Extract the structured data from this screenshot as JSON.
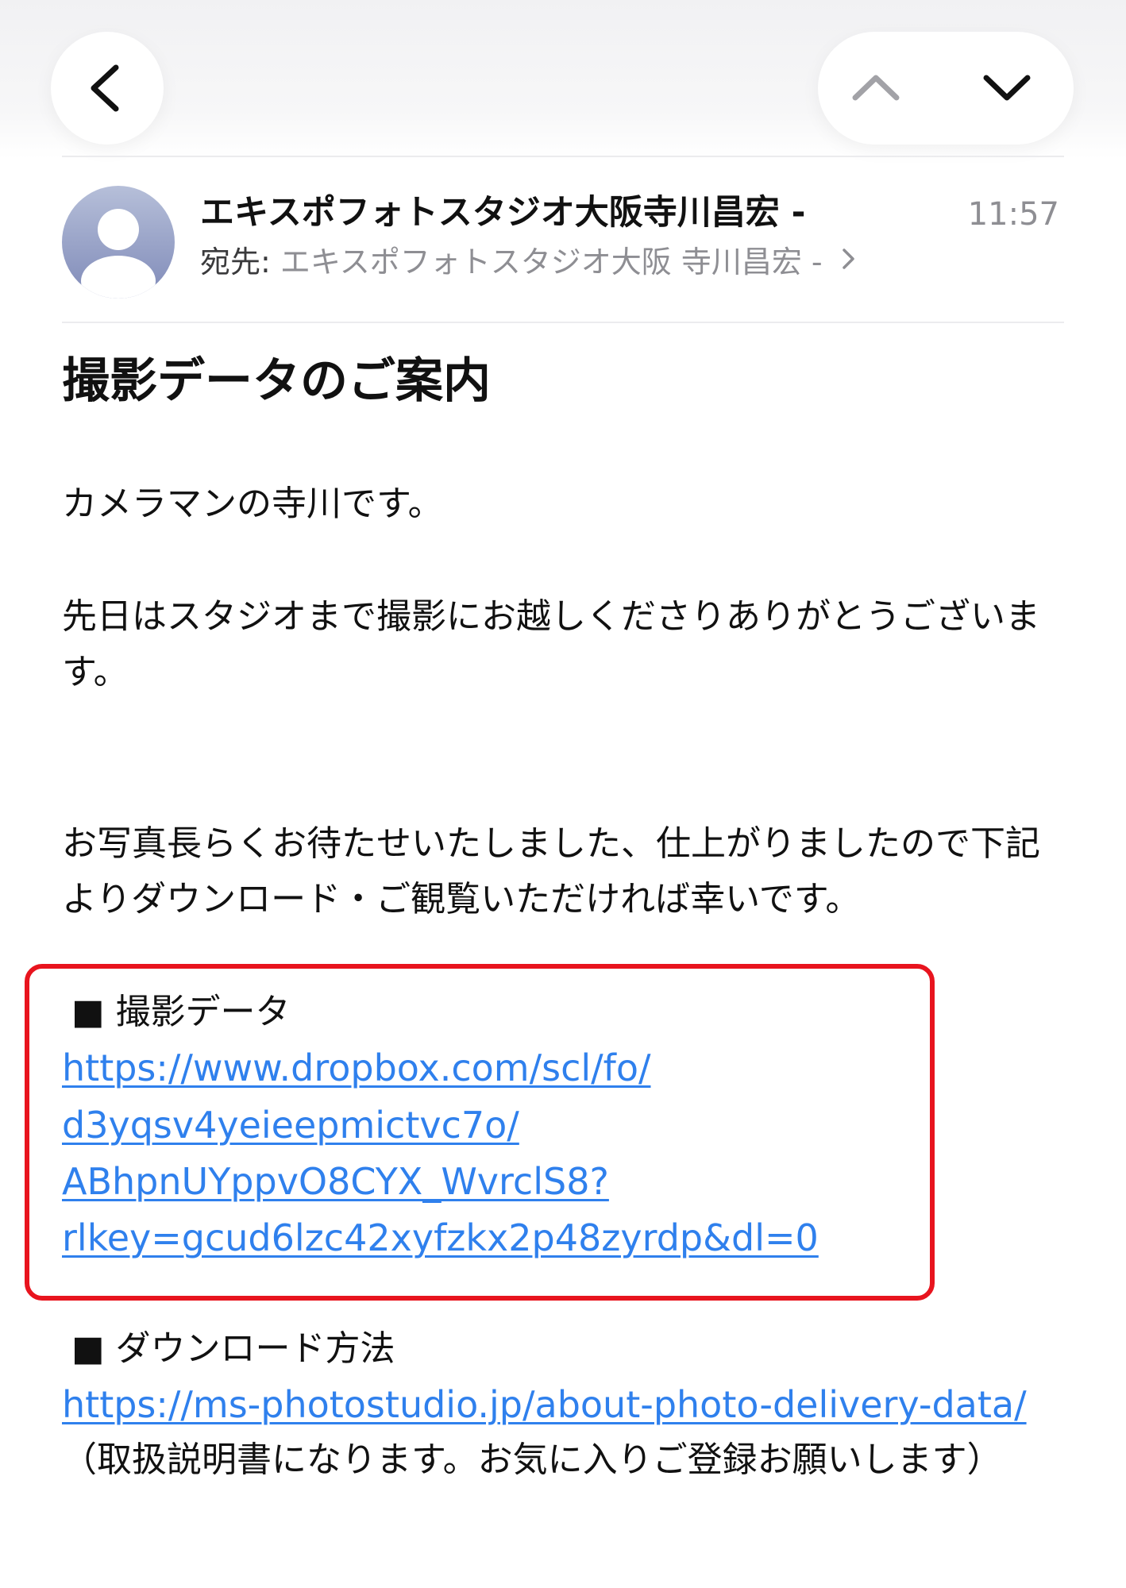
{
  "navigation": {
    "back_icon": "chevron-left-icon",
    "prev_icon": "chevron-up-icon",
    "next_icon": "chevron-down-icon"
  },
  "header": {
    "sender": "エキスポフォトスタジオ大阪寺川昌宏 -",
    "time": "11:57",
    "to_label": "宛先:",
    "to_value": "エキスポフォトスタジオ大阪 寺川昌宏 -",
    "avatar_icon": "person-silhouette-icon"
  },
  "subject": "撮影データのご案内",
  "body": {
    "greeting": "カメラマンの寺川です。",
    "thanks": "先日はスタジオまで撮影にお越しくださりありがとうございます。",
    "message": "お写真長らくお待たせいたしました、仕上がりましたので下記よりダウンロード・ご観覧いただければ幸いです。"
  },
  "photo_data_section": {
    "heading": "■ 撮影データ",
    "link_lines": [
      "https://www.dropbox.com/scl/fo/",
      "d3yqsv4yeieepmictvc7o/",
      "ABhpnUYppvO8CYX_WvrclS8?",
      "rlkey=gcud6lzc42xyfzkx2p48zyrdp&dl=0"
    ],
    "highlight_color": "#e8141e"
  },
  "download_section": {
    "heading": "■ ダウンロード方法",
    "link": "https://ms-photostudio.jp/about-photo-delivery-data/",
    "note": "（取扱説明書になります。お気に入りご登録お願いします）"
  },
  "colors": {
    "link": "#2f80ed",
    "secondary_text": "#8e8e93",
    "highlight": "#e8141e"
  }
}
